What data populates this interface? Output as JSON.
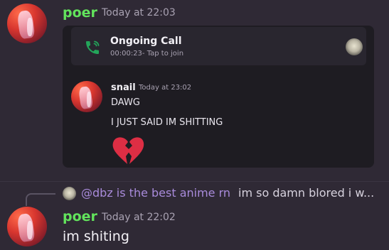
{
  "message_top": {
    "username": "poer",
    "timestamp": "Today at 22:03",
    "embed": {
      "call": {
        "title": "Ongoing Call",
        "subtitle": "00:00:23- Tap to join"
      },
      "forwarded": {
        "username": "snail",
        "timestamp": "Today at 23:02",
        "lines": [
          "DAWG",
          "I JUST SAID IM SHITTING"
        ],
        "emoji": "broken-heart"
      }
    }
  },
  "message_bottom": {
    "reply": {
      "mention": "@dbz is the best anime rn",
      "text": "im so damn blored i w..."
    },
    "username": "poer",
    "timestamp": "Today at 22:02",
    "text": "im shiting"
  },
  "colors": {
    "background": "#2f2935",
    "username": "#62e35c",
    "mention": "#a98bdb",
    "call_icon": "#23a55a",
    "embed_bg": "#1e1c22"
  }
}
